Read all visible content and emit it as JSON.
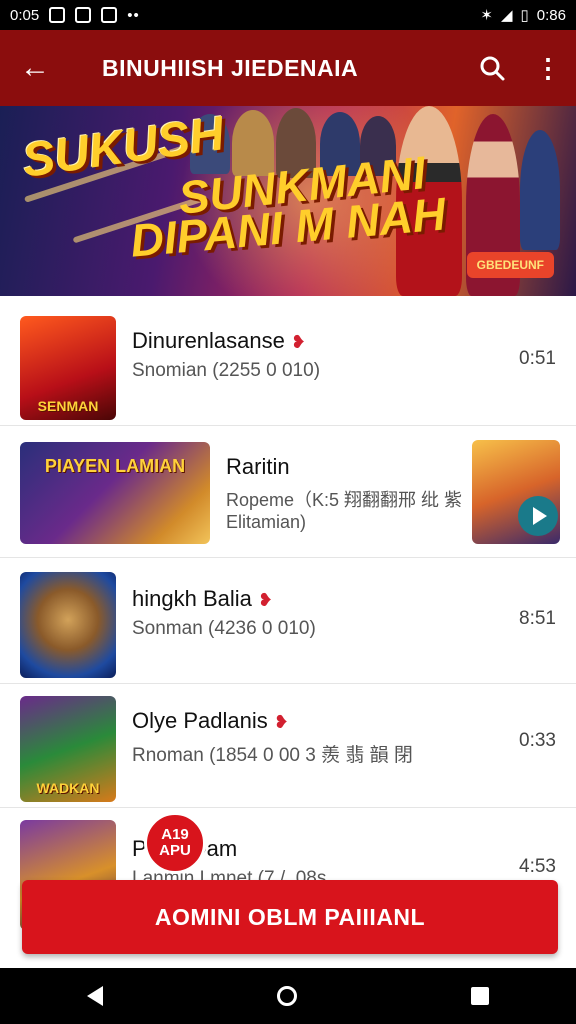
{
  "status_bar": {
    "time": "0:05",
    "battery": "0:86"
  },
  "app_bar": {
    "title": "BINUHIISH JIEDENAIA"
  },
  "banner": {
    "line1": "SUKUSH",
    "line2": "SUNKMANI",
    "line3": "DIPANI M NAH",
    "badge": "GBEDEUNF"
  },
  "list": [
    {
      "title": "Dinurenlasanse",
      "subtitle": "Snomian (2255 0 010)",
      "time": "0:51",
      "thumb_text": "SENMAN"
    },
    {
      "title": "Raritin",
      "subtitle_line1": "Ropeme（K:5 翔翻翻邢 纰 紫",
      "subtitle_line2": "Elitamian)",
      "thumb_text": "PIAYEN LAMIAN"
    },
    {
      "title": "hingkh Balia",
      "subtitle": "Sonman (4236 0 010)",
      "time": "8:51",
      "thumb_text": ""
    },
    {
      "title": "Olye Padlanis",
      "subtitle": "Rnoman (1854 0 00 3 羨 翡 韻 閉",
      "time": "0:33",
      "thumb_text": "WADKAN"
    },
    {
      "title": "PrahnDam",
      "subtitle": "Lanmin Lmnet (7 / .08s",
      "time": "4:53",
      "thumb_text": ""
    }
  ],
  "badge": {
    "line1": "A19",
    "line2": "APU"
  },
  "action_button": {
    "label": "AOMINI OBLM PAIIIANL"
  },
  "colors": {
    "app_bar": "#8b0d0d",
    "accent_red": "#d8141c",
    "banner_yellow": "#ffce2b"
  }
}
